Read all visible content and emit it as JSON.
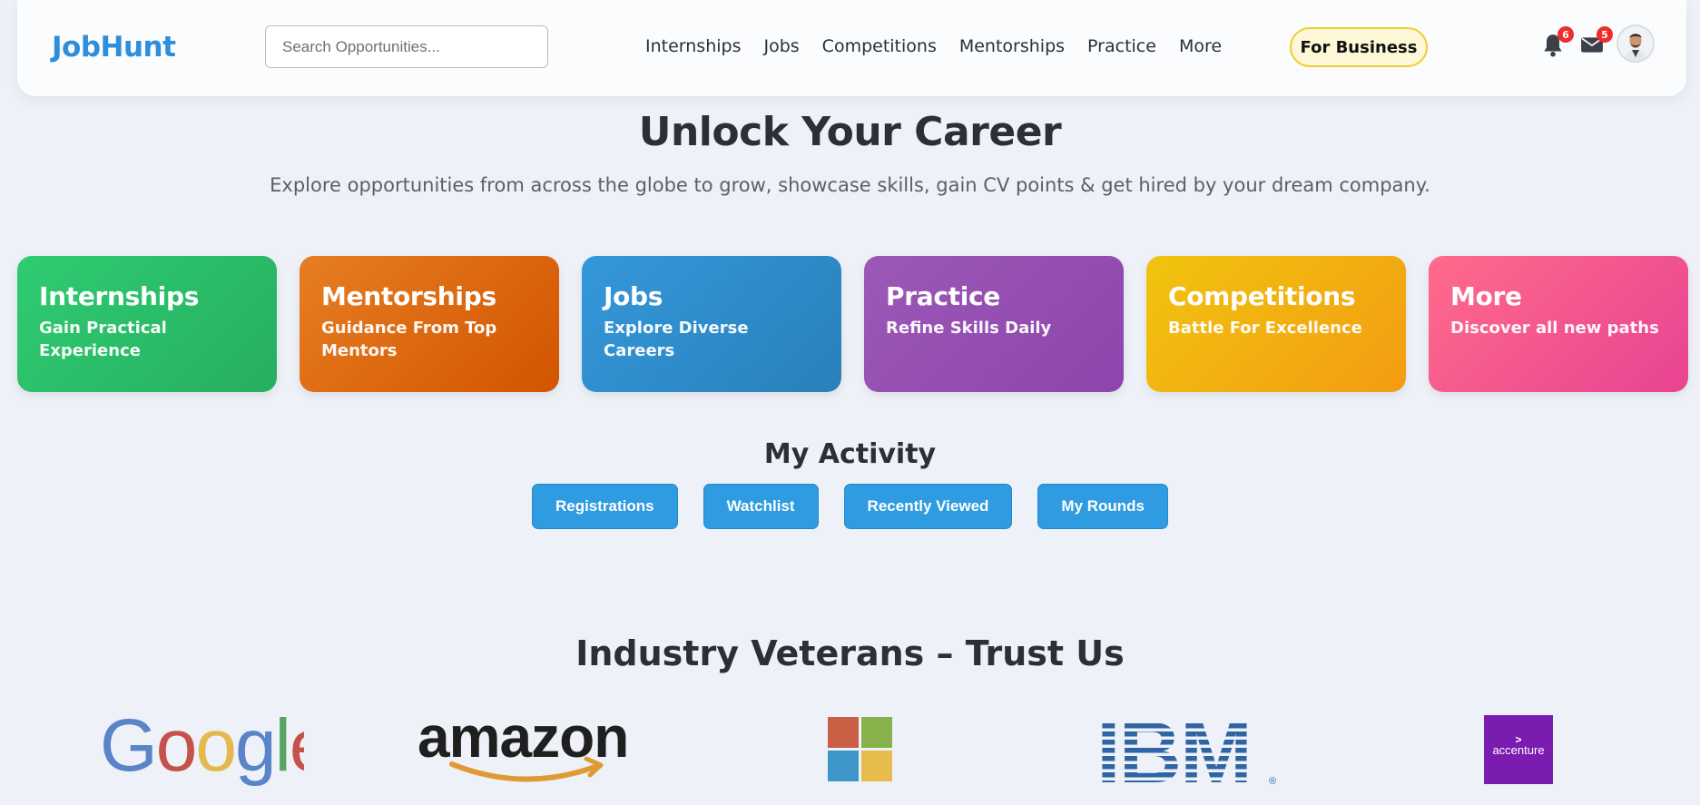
{
  "header": {
    "logo": "JobHunt",
    "search_placeholder": "Search Opportunities...",
    "nav": [
      "Internships",
      "Jobs",
      "Competitions",
      "Mentorships",
      "Practice",
      "More"
    ],
    "business_button": "For Business",
    "notifications_count": "6",
    "messages_count": "5"
  },
  "hero": {
    "title": "Unlock Your Career",
    "subtitle": "Explore opportunities from across the globe to grow, showcase skills, gain CV points & get hired by your dream company."
  },
  "cards": [
    {
      "title": "Internships",
      "subtitle": "Gain Practical Experience",
      "color": "#2ecc71"
    },
    {
      "title": "Mentorships",
      "subtitle": "Guidance From Top Mentors",
      "color": "#e67e22"
    },
    {
      "title": "Jobs",
      "subtitle": "Explore Diverse Careers",
      "color": "#3498db"
    },
    {
      "title": "Practice",
      "subtitle": "Refine Skills Daily",
      "color": "#9b59b6"
    },
    {
      "title": "Competitions",
      "subtitle": "Battle For Excellence",
      "color": "#f1c40f"
    },
    {
      "title": "More",
      "subtitle": "Discover all new paths",
      "color": "#ff6b8a"
    }
  ],
  "activity": {
    "title": "My Activity",
    "buttons": [
      "Registrations",
      "Watchlist",
      "Recently Viewed",
      "My Rounds"
    ]
  },
  "trust": {
    "title": "Industry Veterans – Trust Us",
    "logos": [
      "Google",
      "amazon",
      "Microsoft",
      "IBM",
      "accenture"
    ]
  },
  "colors": {
    "brand": "#2d8fdc",
    "activity_button": "#2f9be0",
    "badge": "#ef2d2d",
    "business_border": "#f2cc2a"
  }
}
